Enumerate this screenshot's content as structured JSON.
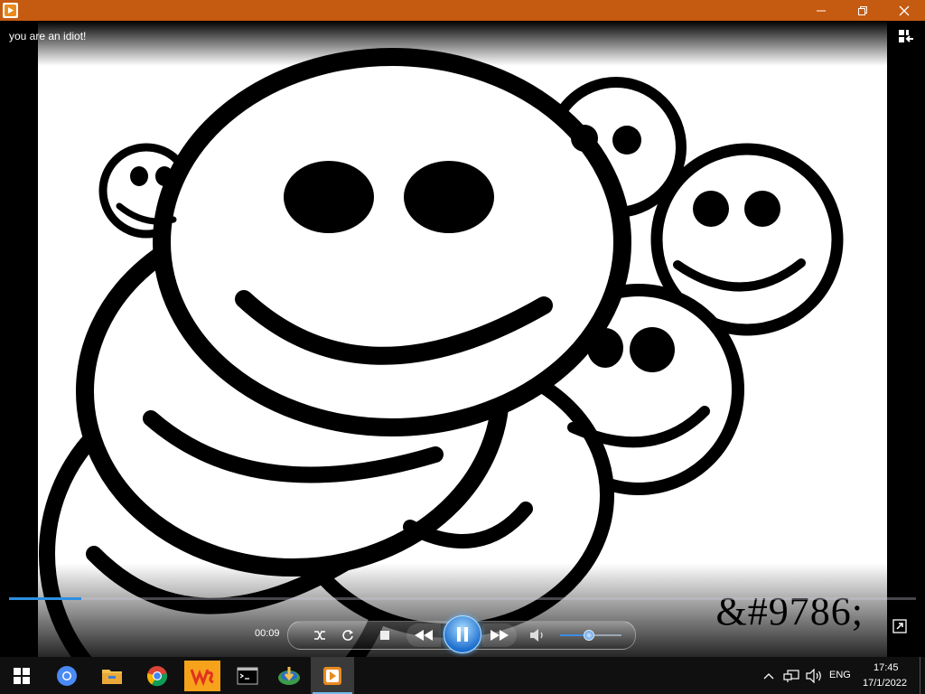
{
  "window": {
    "title": "you are an idiot!",
    "icons": {
      "app": "media-player-icon",
      "minimize": "minimize-icon",
      "restore": "restore-icon",
      "close": "close-icon",
      "switch": "switch-to-library-icon"
    },
    "accent": "#c55a11"
  },
  "video": {
    "caption": "&#9786;",
    "progress": 0.08
  },
  "controls": {
    "time": "00:09",
    "volume": 0.45,
    "icons": [
      "shuffle-icon",
      "repeat-icon",
      "stop-icon",
      "previous-icon",
      "pause-icon",
      "next-icon",
      "volume-icon",
      "fullscreen-icon"
    ]
  },
  "taskbar": {
    "apps": [
      "start-icon",
      "chromium-icon",
      "file-explorer-icon",
      "chrome-icon",
      "wps-office-icon",
      "command-prompt-icon",
      "download-manager-icon",
      "media-player-icon"
    ],
    "language": "ENG",
    "time": "17:45",
    "date": "17/1/2022"
  }
}
